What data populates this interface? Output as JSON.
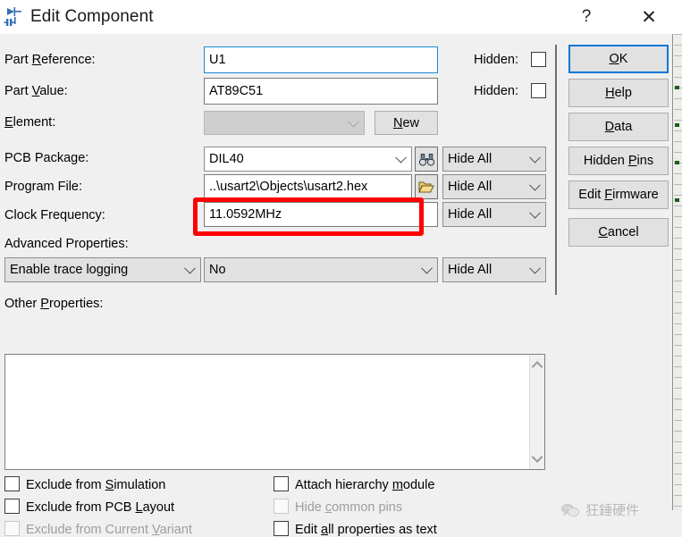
{
  "window": {
    "title": "Edit Component",
    "icon": "component-icon",
    "help_button": "?",
    "close_button": "✕"
  },
  "fields": {
    "part_reference": {
      "label_pre": "Part ",
      "label_mnemonic": "R",
      "label_post": "eference:",
      "value": "U1",
      "hidden_label": "Hidden:",
      "hidden_checked": false
    },
    "part_value": {
      "label_pre": "Part ",
      "label_mnemonic": "V",
      "label_post": "alue:",
      "value": "AT89C51",
      "hidden_label": "Hidden:",
      "hidden_checked": false
    },
    "element": {
      "label_pre": "",
      "label_mnemonic": "E",
      "label_post": "lement:",
      "value": "",
      "new_button": "New",
      "new_button_mnemonic": "N",
      "disabled": true
    },
    "pcb_package": {
      "label": "PCB Package:",
      "value": "DIL40",
      "icon": "binoculars-icon",
      "hide_mode": "Hide All"
    },
    "program_file": {
      "label": "Program File:",
      "value": "..\\usart2\\Objects\\usart2.hex",
      "icon": "folder-open-icon",
      "hide_mode": "Hide All"
    },
    "clock_frequency": {
      "label": "Clock Frequency:",
      "value": "11.0592MHz",
      "hide_mode": "Hide All",
      "highlighted": true
    },
    "advanced_properties": {
      "label": "Advanced Properties:",
      "property": "Enable trace logging",
      "value": "No",
      "hide_mode": "Hide All"
    },
    "other_properties": {
      "label_pre": "Other ",
      "label_mnemonic": "P",
      "label_post": "roperties:",
      "value": ""
    }
  },
  "buttons": [
    {
      "name": "ok",
      "label": "OK",
      "mnemonic": "O",
      "rest": "K",
      "default": true
    },
    {
      "name": "help",
      "label": "Help",
      "mnemonic": "H",
      "rest": "elp",
      "default": false
    },
    {
      "name": "data",
      "label": "Data",
      "mnemonic": "D",
      "rest": "ata",
      "default": false
    },
    {
      "name": "hidden-pins",
      "label": "Hidden Pins",
      "pre": "Hidden ",
      "mnemonic": "P",
      "rest": "ins",
      "default": false
    },
    {
      "name": "edit-firmware",
      "label": "Edit Firmware",
      "pre": "Edit ",
      "mnemonic": "F",
      "rest": "irmware",
      "default": false
    },
    {
      "name": "cancel",
      "label": "Cancel",
      "mnemonic": "C",
      "rest": "ancel",
      "default": false
    }
  ],
  "checkboxes_left": [
    {
      "name": "exclude-simulation",
      "pre": "Exclude from ",
      "mnemonic": "S",
      "post": "imulation",
      "checked": false,
      "disabled": false
    },
    {
      "name": "exclude-pcb-layout",
      "pre": "Exclude from PCB ",
      "mnemonic": "L",
      "post": "ayout",
      "checked": false,
      "disabled": false
    },
    {
      "name": "exclude-current-variant",
      "pre": "Exclude from Current ",
      "mnemonic": "V",
      "post": "ariant",
      "checked": false,
      "disabled": true
    }
  ],
  "checkboxes_right": [
    {
      "name": "attach-hierarchy-module",
      "pre": "Attach hierarchy ",
      "mnemonic": "m",
      "post": "odule",
      "checked": false,
      "disabled": false
    },
    {
      "name": "hide-common-pins",
      "pre": "Hide ",
      "mnemonic": "c",
      "post": "ommon pins",
      "checked": false,
      "disabled": true
    },
    {
      "name": "edit-all-properties",
      "pre": "Edit ",
      "mnemonic": "a",
      "post": "ll properties as text",
      "checked": false,
      "disabled": false
    }
  ],
  "watermark": {
    "text": "狂錘硬件",
    "icon": "wechat-icon"
  },
  "colors": {
    "accent": "#0078d7",
    "highlight": "#fe0000",
    "dialog_bg": "#f0f0f0",
    "control_bg": "#e1e1e1",
    "field_bg": "#ffffff"
  }
}
